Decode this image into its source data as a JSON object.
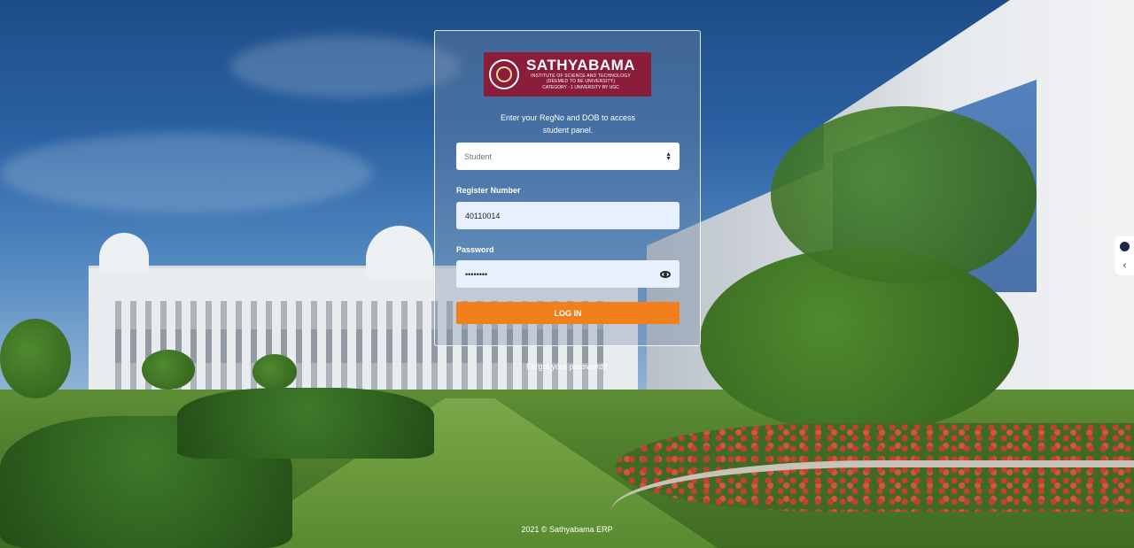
{
  "brand": {
    "name": "SATHYABAMA",
    "subtitle_line1": "INSTITUTE OF SCIENCE AND TECHNOLOGY",
    "subtitle_line2": "(DEEMED TO BE UNIVERSITY)",
    "category": "CATEGORY - 1 UNIVERSITY BY UGC",
    "color": "#8a1d3a"
  },
  "login": {
    "intro_line1": "Enter your RegNo and DOB to access",
    "intro_line2": "student panel.",
    "role_select": {
      "selected": "Student"
    },
    "register_label": "Register Number",
    "register_value": "40110014",
    "password_label": "Password",
    "password_value": "••••••••",
    "login_button": "LOG IN",
    "accent_color": "#f07f1c"
  },
  "links": {
    "forgot_password": "Forgot your password?"
  },
  "footer": {
    "copyright": "2021 © Sathyabama ERP"
  },
  "icons": {
    "password_toggle": "eye-icon",
    "select_arrows": "select-arrows-icon",
    "side_panel_toggle": "chevron-left-icon"
  }
}
